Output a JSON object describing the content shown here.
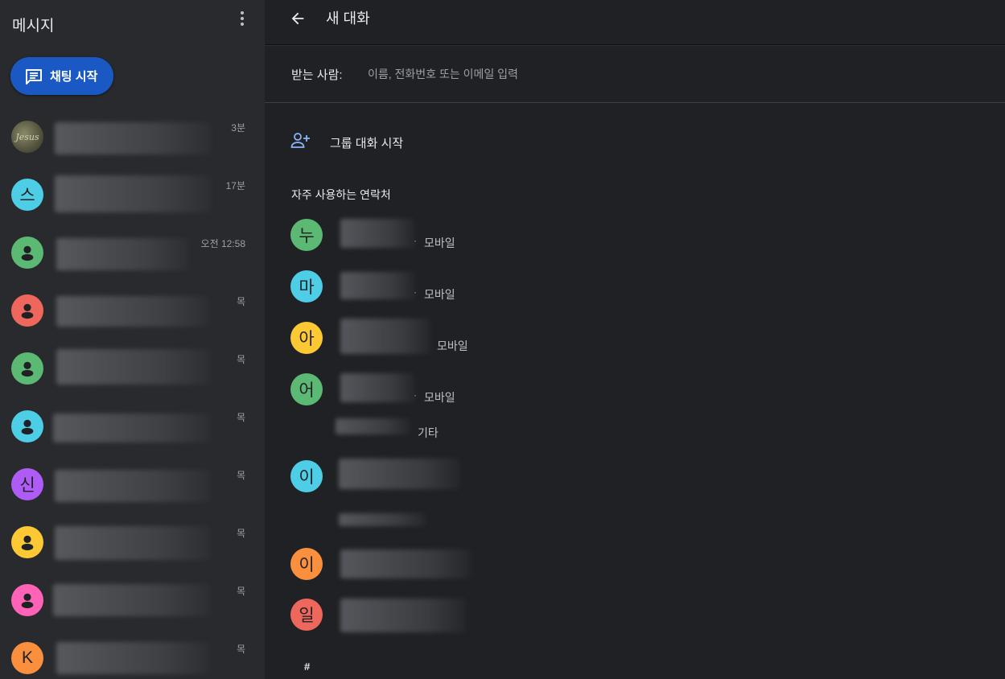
{
  "colors": {
    "accent": "#1a58c4",
    "avatar_green": "#5bb974",
    "avatar_cyan": "#4ecde6",
    "avatar_red": "#ee675c",
    "avatar_purple": "#af5cf7",
    "avatar_yellow": "#fcc934",
    "avatar_pink": "#ff63b8",
    "avatar_orange": "#fa903e"
  },
  "sidebar": {
    "title": "메시지",
    "menu_icon": "more-vert-icon",
    "start_chat_label": "채팅 시작",
    "start_chat_icon": "message-icon",
    "conversations": [
      {
        "avatar": "photo",
        "time": "3분"
      },
      {
        "avatar": "스",
        "color": "#4ecde6",
        "time": "17분"
      },
      {
        "avatar": "person-icon",
        "color": "#5bb974",
        "time": "오전 12:58"
      },
      {
        "avatar": "person-icon",
        "color": "#ee675c",
        "time": "목"
      },
      {
        "avatar": "person-icon",
        "color": "#5bb974",
        "time": "목"
      },
      {
        "avatar": "person-icon",
        "color": "#4ecde6",
        "time": "목"
      },
      {
        "avatar": "신",
        "color": "#af5cf7",
        "time": "목"
      },
      {
        "avatar": "person-icon",
        "color": "#fcc934",
        "time": "목"
      },
      {
        "avatar": "person-icon",
        "color": "#ff63b8",
        "time": "목"
      },
      {
        "avatar": "K",
        "color": "#fa903e",
        "time": "목"
      }
    ]
  },
  "main": {
    "back_icon": "arrow-back-icon",
    "title": "새 대화",
    "to_label": "받는 사람:",
    "to_placeholder": "이름, 전화번호 또는 이메일 입력",
    "group_icon": "person-add-icon",
    "group_label": "그룹 대화 시작",
    "frequent_heading": "자주 사용하는 연락처",
    "contacts": [
      {
        "initial": "누",
        "color": "#5bb974",
        "type": "모바일"
      },
      {
        "initial": "마",
        "color": "#4ecde6",
        "type": "모바일"
      },
      {
        "initial": "아",
        "color": "#fcc934",
        "type": "모바일"
      },
      {
        "initial": "어",
        "color": "#5bb974",
        "type": "모바일",
        "extra_type": "기타"
      },
      {
        "initial": "이",
        "color": "#4ecde6"
      },
      {
        "initial": "이",
        "color": "#fa903e"
      },
      {
        "initial": "일",
        "color": "#ee675c"
      }
    ],
    "section_hash": "#"
  }
}
